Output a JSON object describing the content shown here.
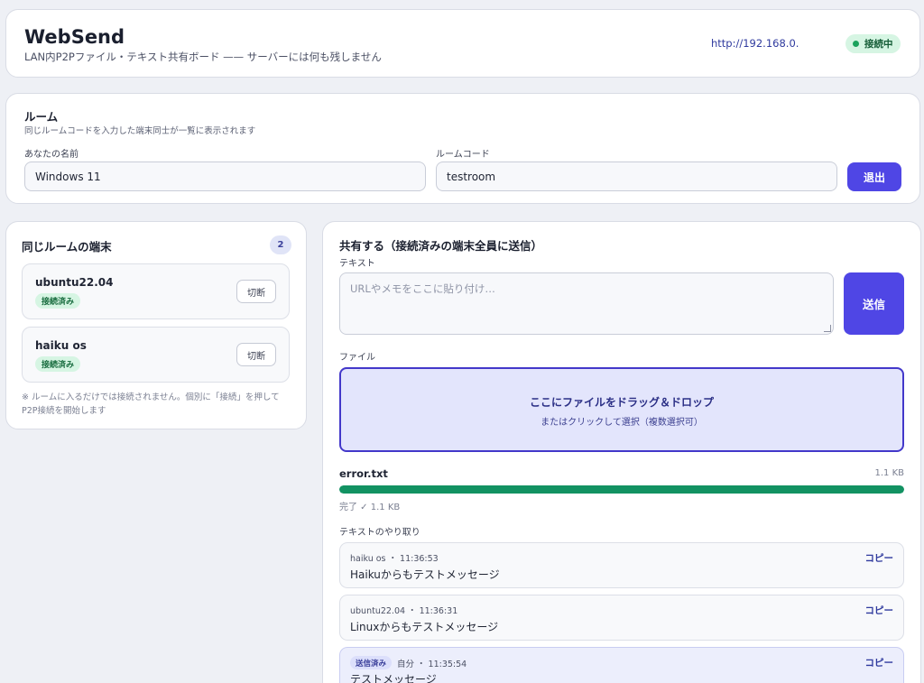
{
  "header": {
    "title": "WebSend",
    "subtitle": "LAN内P2Pファイル・テキスト共有ボード —— サーバーには何も残しません",
    "url": "http://192.168.0.",
    "status": "接続中",
    "status_color": "#1aa35c"
  },
  "room": {
    "title": "ルーム",
    "description": "同じルームコードを入力した端末同士が一覧に表示されます",
    "name_label": "あなたの名前",
    "name_value": "Windows 11",
    "code_label": "ルームコード",
    "code_value": "testroom",
    "leave_label": "退出"
  },
  "peers": {
    "title": "同じルームの端末",
    "count": "2",
    "items": [
      {
        "name": "ubuntu22.04",
        "status": "接続済み",
        "action": "切断"
      },
      {
        "name": "haiku os",
        "status": "接続済み",
        "action": "切断"
      }
    ],
    "note": "※ ルームに入るだけでは接続されません。個別に「接続」を押してP2P接続を開始します"
  },
  "share": {
    "title": "共有する（接続済みの端末全員に送信）",
    "text_label": "テキスト",
    "text_placeholder": "URLやメモをここに貼り付け…",
    "send_label": "送信",
    "file_label": "ファイル",
    "drop_main": "ここにファイルをドラッグ＆ドロップ",
    "drop_sub": "またはクリックして選択（複数選択可）",
    "transfer": {
      "file_name": "error.txt",
      "size": "1.1 KB",
      "progress": 1.0,
      "status": "完了 ✓ 1.1 KB"
    },
    "history_label": "テキストのやり取り",
    "messages": [
      {
        "meta": "haiku os ・ 11:36:53",
        "text": "Haikuからもテストメッセージ",
        "copy": "コピー"
      },
      {
        "meta": "ubuntu22.04 ・ 11:36:31",
        "text": "Linuxからもテストメッセージ",
        "copy": "コピー"
      },
      {
        "badge": "送信済み",
        "meta": "自分 ・ 11:35:54",
        "text": "テストメッセージ",
        "copy": "コピー"
      }
    ]
  },
  "colors": {
    "accent": "#4f46e5",
    "success": "#129262",
    "background": "#eef0f5"
  }
}
